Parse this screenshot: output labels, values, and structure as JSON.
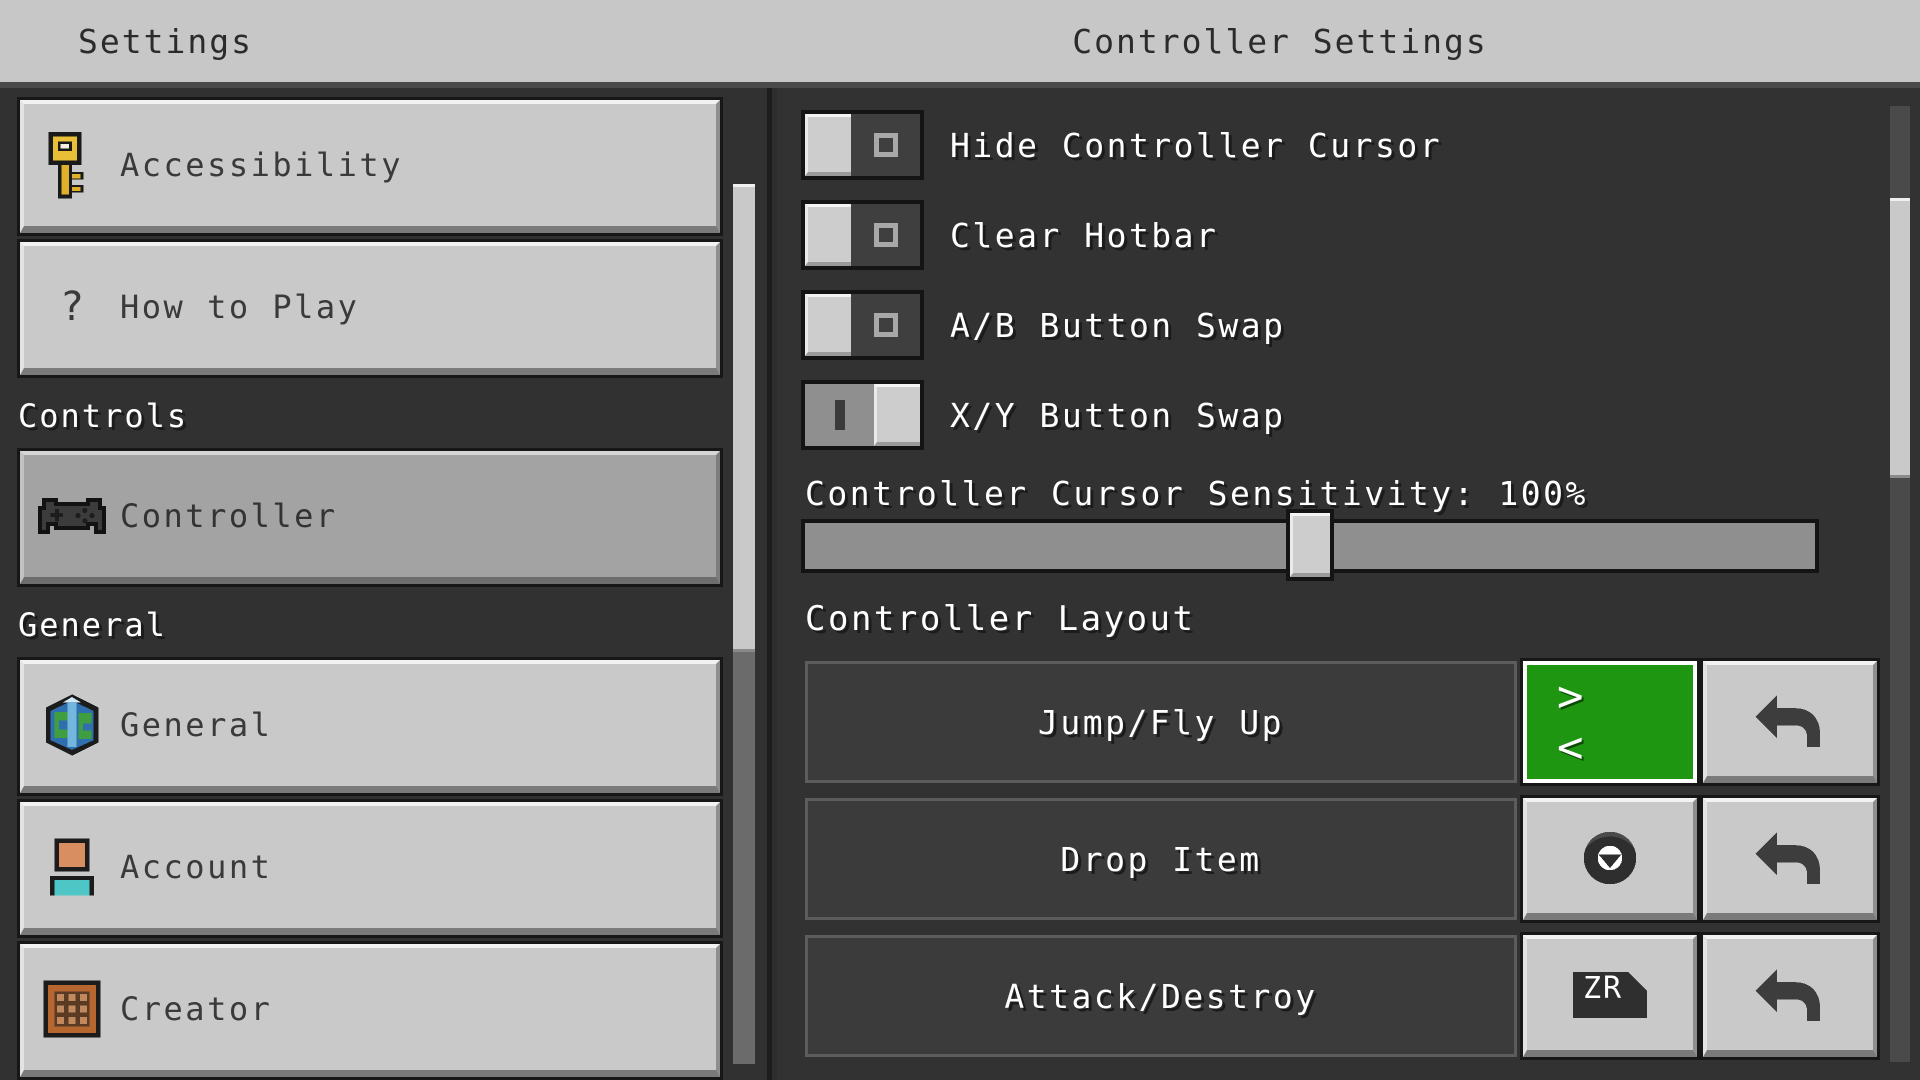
{
  "header": {
    "left_title": "Settings",
    "right_title": "Controller Settings"
  },
  "sidebar": {
    "items": [
      {
        "label": "Accessibility",
        "icon": "key-icon",
        "selected": false
      },
      {
        "label": "How to Play",
        "icon": "question-mark-icon",
        "selected": false
      }
    ],
    "sections": [
      {
        "title": "Controls",
        "items": [
          {
            "label": "Controller",
            "icon": "gamepad-icon",
            "selected": true
          }
        ]
      },
      {
        "title": "General",
        "items": [
          {
            "label": "General",
            "icon": "earth-block-icon",
            "selected": false
          },
          {
            "label": "Account",
            "icon": "player-head-icon",
            "selected": false
          },
          {
            "label": "Creator",
            "icon": "crafting-table-icon",
            "selected": false
          }
        ]
      }
    ],
    "scrollbar": {
      "name": "sidebar-scrollbar"
    }
  },
  "panel": {
    "toggles": [
      {
        "label": "Hide Controller Cursor",
        "state": "off",
        "glyph": "o"
      },
      {
        "label": "Clear Hotbar",
        "state": "off",
        "glyph": "o"
      },
      {
        "label": "A/B Button Swap",
        "state": "off",
        "glyph": "o"
      },
      {
        "label": "X/Y Button Swap",
        "state": "on",
        "glyph": "i"
      }
    ],
    "slider": {
      "label": "Controller Cursor Sensitivity: 100%",
      "value": 100,
      "min": 0,
      "max": 200,
      "knob_percent": 50
    },
    "layout": {
      "title": "Controller Layout",
      "rows": [
        {
          "action": "Jump/Fly Up",
          "binding_glyph": "> <",
          "binding_type": "green-arrows",
          "revert": "revert-arrow-icon"
        },
        {
          "action": "Drop Item",
          "binding_glyph": "",
          "binding_type": "stick-button",
          "revert": "revert-arrow-icon"
        },
        {
          "action": "Attack/Destroy",
          "binding_glyph": "ZR",
          "binding_type": "trigger-button",
          "revert": "revert-arrow-icon"
        }
      ]
    },
    "scrollbar": {
      "name": "panel-scrollbar"
    }
  },
  "colors": {
    "accent_green": "#1f9612",
    "panel_bg": "#323232",
    "sidebar_bg": "#313131",
    "button_face": "#c9c9c9",
    "header_bg": "#c7c7c7"
  }
}
